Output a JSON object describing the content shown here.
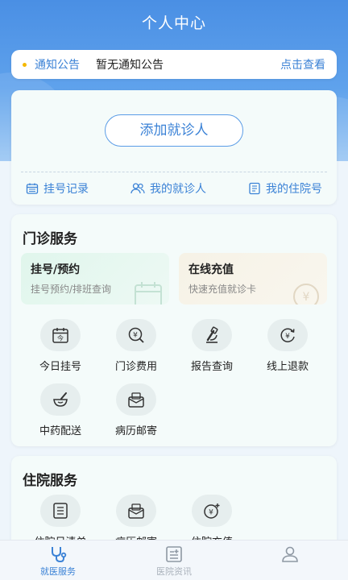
{
  "header": {
    "title": "个人中心"
  },
  "notice": {
    "label": "通知公告",
    "text": "暂无通知公告",
    "more": "点击查看"
  },
  "patient": {
    "add_button": "添加就诊人",
    "links": [
      {
        "label": "挂号记录",
        "icon": "calendar-icon"
      },
      {
        "label": "我的就诊人",
        "icon": "users-icon"
      },
      {
        "label": "我的住院号",
        "icon": "document-icon"
      }
    ]
  },
  "outpatient": {
    "title": "门诊服务",
    "features": [
      {
        "title": "挂号/预约",
        "subtitle": "挂号预约/排班查询"
      },
      {
        "title": "在线充值",
        "subtitle": "快速充值就诊卡"
      }
    ],
    "items": [
      {
        "label": "今日挂号",
        "icon": "calendar-today-icon"
      },
      {
        "label": "门诊费用",
        "icon": "search-yen-icon"
      },
      {
        "label": "报告查询",
        "icon": "microscope-icon"
      },
      {
        "label": "线上退款",
        "icon": "refund-yen-icon"
      },
      {
        "label": "中药配送",
        "icon": "mortar-icon"
      },
      {
        "label": "病历邮寄",
        "icon": "mailbox-icon"
      }
    ]
  },
  "inpatient": {
    "title": "住院服务",
    "items": [
      {
        "label": "住院日清单",
        "icon": "list-icon"
      },
      {
        "label": "病历邮寄",
        "icon": "mailbox-icon"
      },
      {
        "label": "住院充值",
        "icon": "recharge-yen-icon"
      }
    ]
  },
  "tabbar": [
    {
      "label": "就医服务",
      "icon": "stethoscope-icon",
      "active": true
    },
    {
      "label": "医院资讯",
      "icon": "news-icon",
      "active": false
    },
    {
      "label": "",
      "icon": "profile-icon",
      "active": false
    }
  ],
  "colors": {
    "primary": "#3b82d6",
    "header": "#4a8fe4",
    "icon": "#333333"
  }
}
